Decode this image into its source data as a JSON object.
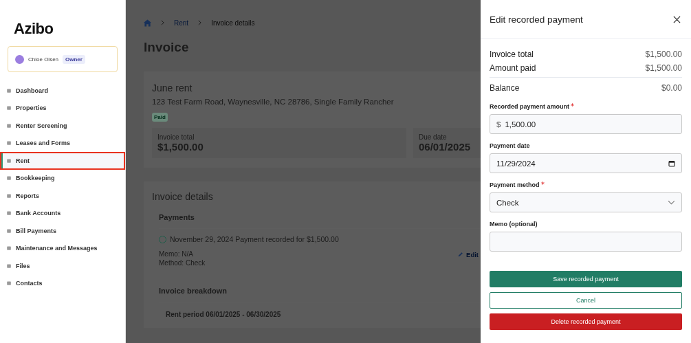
{
  "sidebar": {
    "logo": "Azibo",
    "user": {
      "name": "Chloe Olsen",
      "role": "Owner"
    },
    "items": [
      {
        "label": "Dashboard",
        "selected": false
      },
      {
        "label": "Properties",
        "selected": false
      },
      {
        "label": "Renter Screening",
        "selected": false
      },
      {
        "label": "Leases and Forms",
        "selected": false
      },
      {
        "label": "Rent",
        "selected": true
      },
      {
        "label": "Bookkeeping",
        "selected": false
      },
      {
        "label": "Reports",
        "selected": false
      },
      {
        "label": "Bank Accounts",
        "selected": false
      },
      {
        "label": "Bill Payments",
        "selected": false
      },
      {
        "label": "Maintenance and Messages",
        "selected": false
      },
      {
        "label": "Files",
        "selected": false
      },
      {
        "label": "Contacts",
        "selected": false
      }
    ]
  },
  "breadcrumb": [
    {
      "label": "Rent",
      "kind": "link"
    },
    {
      "label": "Invoice details",
      "kind": "current"
    }
  ],
  "page_title": "Invoice",
  "invoice": {
    "title": "June rent",
    "address": "123 Test Farm Road, Waynesville, NC 28786, Single Family Rancher",
    "status": "Paid",
    "stats": [
      {
        "label": "Invoice total",
        "value": "$1,500.00"
      },
      {
        "label": "Due date",
        "value": "06/01/2025"
      }
    ]
  },
  "details": {
    "heading": "Invoice details",
    "payments_heading": "Payments",
    "payment": {
      "summary": "November 29, 2024 Payment recorded for $1,500.00",
      "memo": "Memo: N/A",
      "method": "Method: Check",
      "edit": "Edit"
    },
    "breakdown_heading": "Invoice breakdown",
    "rent_period": "Rent period 06/01/2025 - 06/30/2025"
  },
  "drawer": {
    "title": "Edit recorded payment",
    "summary": [
      {
        "label": "Invoice total",
        "value": "$1,500.00",
        "kind": "line"
      },
      {
        "label": "Amount paid",
        "value": "$1,500.00",
        "kind": "line"
      },
      {
        "label": "Balance",
        "value": "$0.00",
        "kind": "total"
      }
    ],
    "fields": [
      {
        "kind": "amount",
        "label": "Recorded payment amount",
        "required": true,
        "prefix": "$",
        "value": "1,500.00"
      },
      {
        "kind": "date",
        "label": "Payment date",
        "required": false,
        "value": "11/29/2024"
      },
      {
        "kind": "select",
        "label": "Payment method",
        "required": true,
        "value": "Check"
      },
      {
        "kind": "text",
        "label": "Memo (optional)",
        "required": false
      }
    ],
    "buttons": [
      {
        "kind": "primary",
        "label": "Save recorded payment"
      },
      {
        "kind": "outline",
        "label": "Cancel"
      },
      {
        "kind": "danger",
        "label": "Delete recorded payment"
      }
    ]
  }
}
